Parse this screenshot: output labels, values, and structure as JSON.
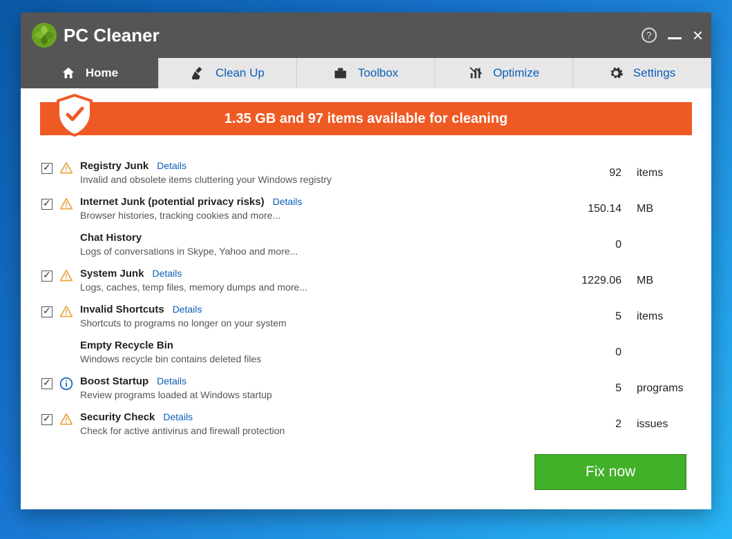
{
  "app": {
    "title": "PC Cleaner"
  },
  "window_controls": {
    "help": "?",
    "minimize": "_",
    "close": "×"
  },
  "tabs": [
    {
      "label": "Home",
      "icon": "home-icon"
    },
    {
      "label": "Clean Up",
      "icon": "broom-icon"
    },
    {
      "label": "Toolbox",
      "icon": "toolbox-icon"
    },
    {
      "label": "Optimize",
      "icon": "chart-icon"
    },
    {
      "label": "Settings",
      "icon": "gear-icon"
    }
  ],
  "banner": {
    "text": "1.35 GB and 97 items available for cleaning"
  },
  "details_label": "Details",
  "items": [
    {
      "title": "Registry Junk",
      "desc": "Invalid and obsolete items cluttering your Windows registry",
      "value": "92",
      "unit": "items",
      "checked": true,
      "icon": "warn",
      "details": true
    },
    {
      "title": "Internet Junk (potential privacy risks)",
      "desc": "Browser histories, tracking cookies and more...",
      "value": "150.14",
      "unit": "MB",
      "checked": true,
      "icon": "warn",
      "details": true
    },
    {
      "title": "Chat History",
      "desc": "Logs of conversations in Skype, Yahoo and more...",
      "value": "0",
      "unit": "",
      "checked": false,
      "icon": "none",
      "details": false
    },
    {
      "title": "System Junk",
      "desc": "Logs, caches, temp files, memory dumps and more...",
      "value": "1229.06",
      "unit": "MB",
      "checked": true,
      "icon": "warn",
      "details": true
    },
    {
      "title": "Invalid Shortcuts",
      "desc": "Shortcuts to programs no longer on your system",
      "value": "5",
      "unit": "items",
      "checked": true,
      "icon": "warn",
      "details": true
    },
    {
      "title": "Empty Recycle Bin",
      "desc": "Windows recycle bin contains deleted files",
      "value": "0",
      "unit": "",
      "checked": false,
      "icon": "none",
      "details": false
    },
    {
      "title": "Boost Startup",
      "desc": "Review programs loaded at Windows startup",
      "value": "5",
      "unit": "programs",
      "checked": true,
      "icon": "info",
      "details": true
    },
    {
      "title": "Security Check",
      "desc": "Check for active antivirus and firewall protection",
      "value": "2",
      "unit": "issues",
      "checked": true,
      "icon": "warn",
      "details": true
    }
  ],
  "action": {
    "fix_label": "Fix now"
  },
  "colors": {
    "accent_orange": "#ef5a24",
    "accent_green": "#43b02a",
    "link": "#0b5dba",
    "titlebar": "#555555"
  }
}
